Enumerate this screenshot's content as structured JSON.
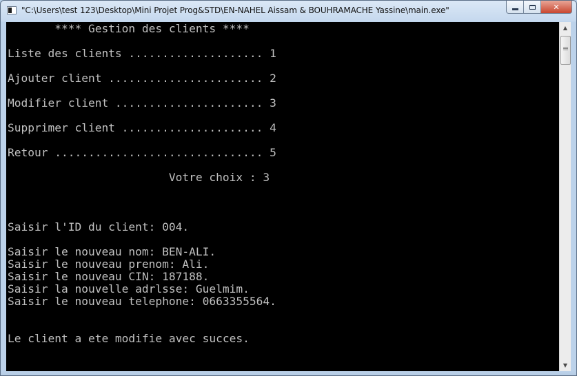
{
  "window": {
    "title": "\"C:\\Users\\test 123\\Desktop\\Mini Projet Prog&STD\\EN-NAHEL Aissam & BOUHRAMACHE Yassine\\main.exe\""
  },
  "console": {
    "lines": [
      "       **** Gestion des clients ****",
      "Liste des clients .................... 1",
      "Ajouter client ....................... 2",
      "Modifier client ...................... 3",
      "Supprimer client ..................... 4",
      "Retour ............................... 5",
      "                        Votre choix : 3",
      "Saisir l'ID du client: 004.",
      "Saisir le nouveau nom: BEN-ALI.",
      "Saisir le nouveau prenom: Ali.",
      "Saisir le nouveau CIN: 187188.",
      "Saisir la nouvelle adrlsse: Guelmim.",
      "Saisir le nouveau telephone: 0663355564.",
      "Le client a ete modifie avec succes."
    ]
  }
}
